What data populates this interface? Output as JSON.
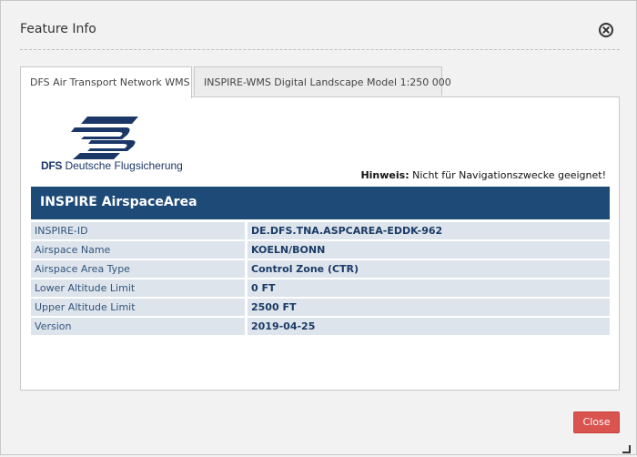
{
  "dialog": {
    "title": "Feature Info",
    "close_icon": "close-circle-icon",
    "close_button_label": "Close"
  },
  "tabs": [
    {
      "label": "DFS Air Transport Network WMS",
      "active": true
    },
    {
      "label": "INSPIRE-WMS Digital Landscape Model 1:250 000",
      "active": false
    }
  ],
  "panel": {
    "logo": {
      "abbr": "DFS",
      "name": "Deutsche Flugsicherung",
      "color": "#1b3768"
    },
    "hint": {
      "label": "Hinweis:",
      "text": "Nicht für Navigationszwecke geeignet!"
    },
    "feature_title": "INSPIRE AirspaceArea",
    "header_color": "#1e4a78",
    "rows": [
      {
        "key": "INSPIRE-ID",
        "value": "DE.DFS.TNA.ASPCAREA-EDDK-962"
      },
      {
        "key": "Airspace Name",
        "value": "KOELN/BONN"
      },
      {
        "key": "Airspace Area Type",
        "value": "Control Zone (CTR)"
      },
      {
        "key": "Lower Altitude Limit",
        "value": "0 FT"
      },
      {
        "key": "Upper Altitude Limit",
        "value": "2500 FT"
      },
      {
        "key": "Version",
        "value": "2019-04-25"
      }
    ]
  },
  "accent_color": "#d9534f"
}
